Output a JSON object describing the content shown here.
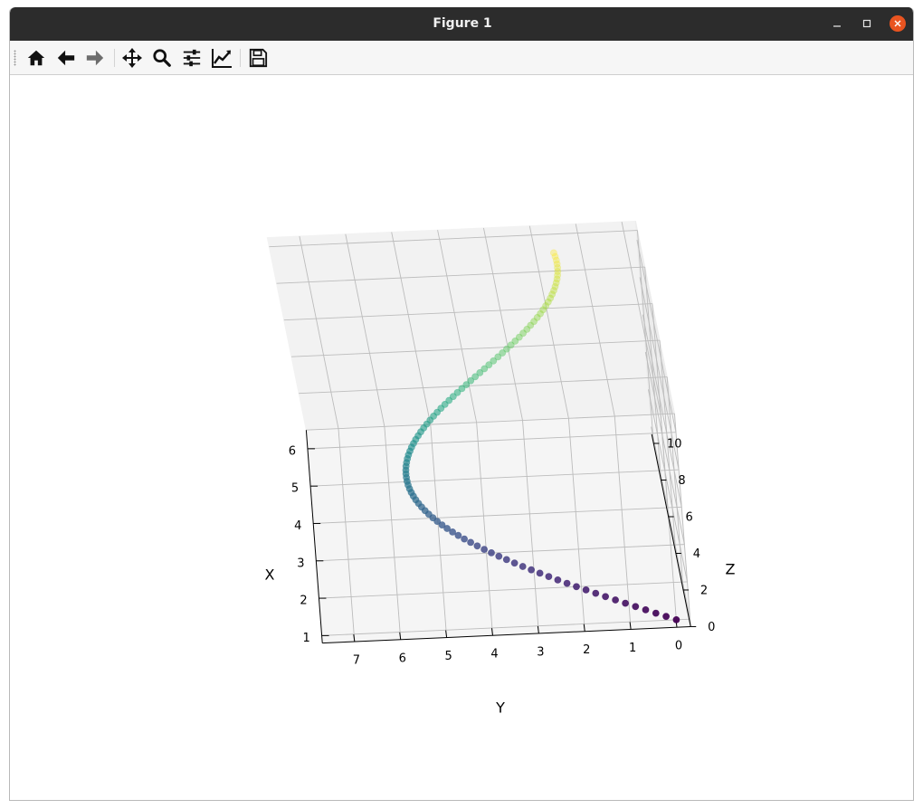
{
  "window": {
    "title": "Figure 1"
  },
  "toolbar": {
    "buttons": [
      {
        "name": "home-button",
        "icon": "home-icon",
        "tooltip": "Reset original view"
      },
      {
        "name": "back-button",
        "icon": "arrow-left-icon",
        "tooltip": "Back to previous view"
      },
      {
        "name": "forward-button",
        "icon": "arrow-right-icon",
        "tooltip": "Forward to next view"
      },
      {
        "name": "pan-button",
        "icon": "move-icon",
        "tooltip": "Pan axes"
      },
      {
        "name": "zoom-button",
        "icon": "magnifier-icon",
        "tooltip": "Zoom to rectangle"
      },
      {
        "name": "subplots-button",
        "icon": "sliders-icon",
        "tooltip": "Configure subplots"
      },
      {
        "name": "customize-button",
        "icon": "line-chart-icon",
        "tooltip": "Edit axis, curve and image parameters"
      },
      {
        "name": "save-button",
        "icon": "floppy-disk-icon",
        "tooltip": "Save the figure"
      }
    ]
  },
  "chart_data": {
    "type": "scatter",
    "projection": "3d",
    "colormap": "viridis",
    "colormap_stops": [
      "#440154",
      "#472c7a",
      "#3b518b",
      "#2c718e",
      "#21908d",
      "#27ad81",
      "#5cc863",
      "#aadc32",
      "#fde725"
    ],
    "xlabel": "X",
    "ylabel": "Y",
    "zlabel": "Z",
    "xticks": [
      1,
      2,
      3,
      4,
      5,
      6
    ],
    "yticks": [
      7,
      6,
      5,
      4,
      3,
      2,
      1,
      0
    ],
    "zticks": [
      0,
      2,
      4,
      6,
      8,
      10
    ],
    "xlim": [
      0.8,
      6.5
    ],
    "ylim": [
      -0.3,
      7.7
    ],
    "zlim": [
      0,
      10.5
    ],
    "grid": true,
    "points_description": "helix-like curve: x = 1 + 0.5*z, y = 0.5*z + 3.5*sin(z/2.2) (approx), z from 0 to 10, color by z",
    "z_range": [
      0,
      10
    ],
    "num_points": 100
  }
}
